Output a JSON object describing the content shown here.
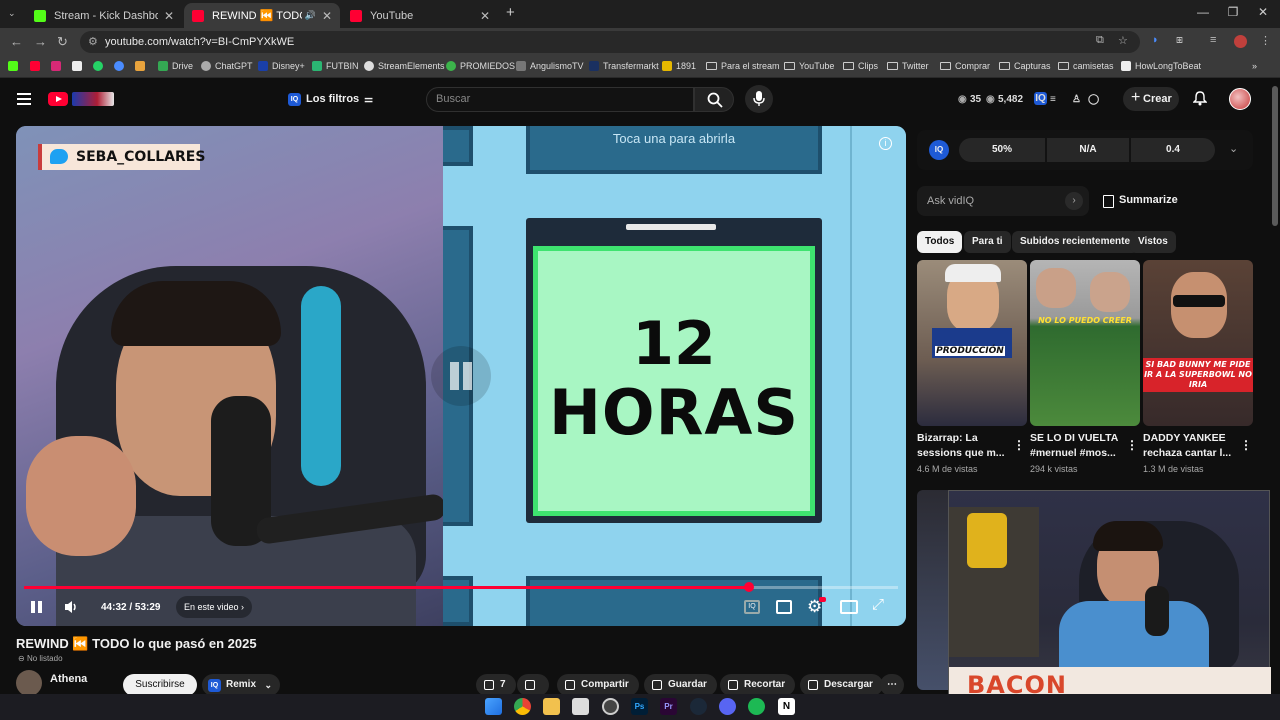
{
  "browser": {
    "tabs": [
      {
        "title": "Stream - Kick Dashboard",
        "icon": "kick-icon",
        "color": "#53fc18"
      },
      {
        "title": "REWIND ⏮️ TODO lo que p",
        "icon": "youtube-icon",
        "color": "#ff0033",
        "active": true
      },
      {
        "title": "YouTube",
        "icon": "youtube-icon",
        "color": "#ff0033"
      }
    ],
    "url": "youtube.com/watch?v=BI-CmPYXkWE",
    "bookmarks": [
      "Drive",
      "ChatGPT",
      "Disney+",
      "FUTBIN",
      "StreamElements",
      "PROMIEDOS",
      "AngulismoTV",
      "Transfermarkt",
      "1891",
      "Para el stream",
      "YouTube",
      "Clips",
      "Twitter",
      "Comprar",
      "Capturas",
      "camisetas",
      "HowLongToBeat"
    ]
  },
  "header": {
    "filters_label": "Los filtros",
    "search_placeholder": "Buscar",
    "stat1": "35",
    "stat2": "5,482",
    "create_label": "Crear"
  },
  "player": {
    "twitter_handle": "SEBA_COLLARES",
    "game_hint": "Toca una para abrirla",
    "card_number": "12",
    "card_unit": "HORAS",
    "time": "44:32 / 53:29",
    "chapter": "En este video",
    "progress": 0.83,
    "accent": "#ff0033"
  },
  "video": {
    "title": "REWIND ⏮️ TODO lo que pasó en 2025",
    "visibility": "No listado",
    "channel": "Athena",
    "subscribe": "Suscribirse",
    "remix": "Remix",
    "likes": "7",
    "share": "Compartir",
    "save": "Guardar",
    "clip": "Recortar",
    "download": "Descargar"
  },
  "vidiq": {
    "metrics": [
      "50%",
      "N/A",
      "0.4"
    ],
    "ask_placeholder": "Ask vidIQ",
    "summarize": "Summarize"
  },
  "chips": [
    "Todos",
    "Para ti",
    "Subidos recientemente",
    "Vistos"
  ],
  "recommended": [
    {
      "title": "Bizarrap: La sessions que m...",
      "views": "4.6 M de vistas",
      "caption": "PRODUCCIÓN"
    },
    {
      "title": "SE LO DI VUELTA #mernuel #mos...",
      "views": "294 k vistas",
      "caption": "NO LO PUEDO CREER"
    },
    {
      "title": "DADDY YANKEE rechaza cantar l...",
      "views": "1.3 M de vistas",
      "caption": "SI BAD BUNNY ME PIDE IR A LA SUPERBOWL NO IRIA"
    }
  ],
  "overlay": {
    "brand": "BACON"
  }
}
